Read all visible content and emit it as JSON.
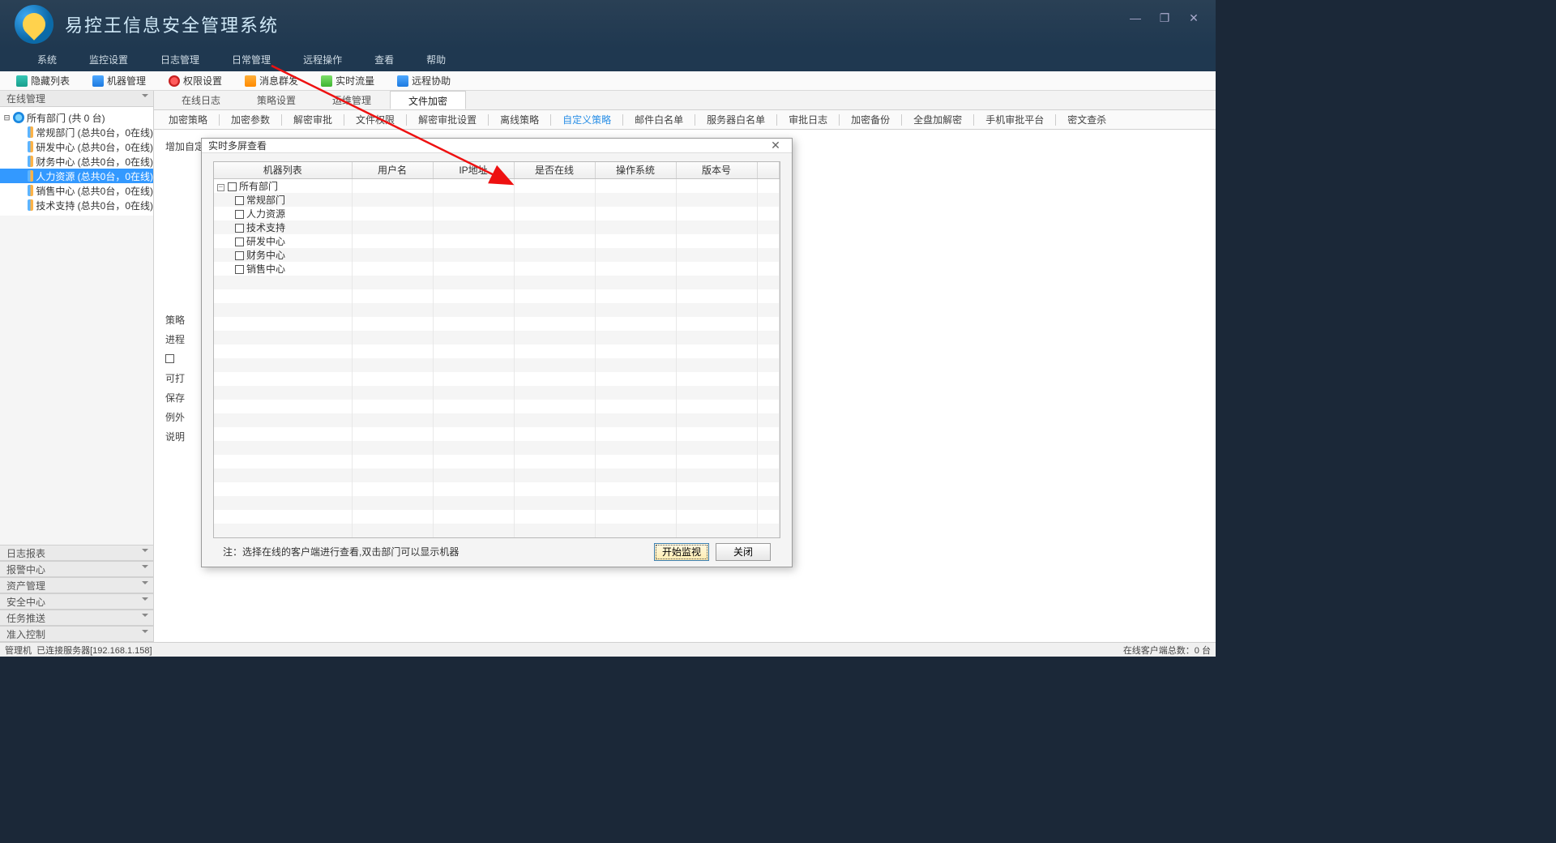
{
  "app": {
    "title": "易控王信息安全管理系统"
  },
  "window_buttons": {
    "min": "—",
    "max": "❐",
    "close": "✕"
  },
  "menu": [
    "系统",
    "监控设置",
    "日志管理",
    "日常管理",
    "远程操作",
    "查看",
    "帮助"
  ],
  "toolbar": [
    {
      "label": "隐藏列表"
    },
    {
      "label": "机器管理"
    },
    {
      "label": "权限设置"
    },
    {
      "label": "消息群发"
    },
    {
      "label": "实时流量"
    },
    {
      "label": "远程协助"
    }
  ],
  "sidebar": {
    "panel_label": "在线管理",
    "root": "所有部门 (共 0 台)",
    "departments": [
      "常规部门 (总共0台，0在线)",
      "研发中心 (总共0台，0在线)",
      "财务中心 (总共0台，0在线)",
      "人力资源 (总共0台，0在线)",
      "销售中心 (总共0台，0在线)",
      "技术支持 (总共0台，0在线)"
    ],
    "selected_index": 3,
    "lower_panels": [
      "日志报表",
      "报警中心",
      "资产管理",
      "安全中心",
      "任务推送",
      "准入控制"
    ]
  },
  "tabs1": {
    "items": [
      "在线日志",
      "策略设置",
      "运维管理",
      "文件加密"
    ],
    "active": 3
  },
  "tabs2": {
    "items": [
      "加密策略",
      "加密参数",
      "解密审批",
      "文件权限",
      "解密审批设置",
      "离线策略",
      "自定义策略",
      "邮件白名单",
      "服务器白名单",
      "审批日志",
      "加密备份",
      "全盘加解密",
      "手机审批平台",
      "密文查杀"
    ],
    "active": 6
  },
  "form": {
    "row1": "增加自定",
    "row2": "策略",
    "row3": "进程",
    "row4_checkbox": "",
    "row5": "可打",
    "row6": "保存",
    "row7": "例外",
    "row8": "说明"
  },
  "dialog": {
    "title": "实时多屏查看",
    "columns": [
      "机器列表",
      "用户名",
      "IP地址",
      "是否在线",
      "操作系统",
      "版本号"
    ],
    "tree_root": "所有部门",
    "tree_items": [
      "常规部门",
      "人力资源",
      "技术支持",
      "研发中心",
      "财务中心",
      "销售中心"
    ],
    "note": "注：选择在线的客户端进行查看,双击部门可以显示机器",
    "btn_start": "开始监视",
    "btn_close": "关闭"
  },
  "status": {
    "left1": "管理机",
    "left2": "已连接服务器[192.168.1.158]",
    "right": "在线客户端总数：0 台"
  }
}
